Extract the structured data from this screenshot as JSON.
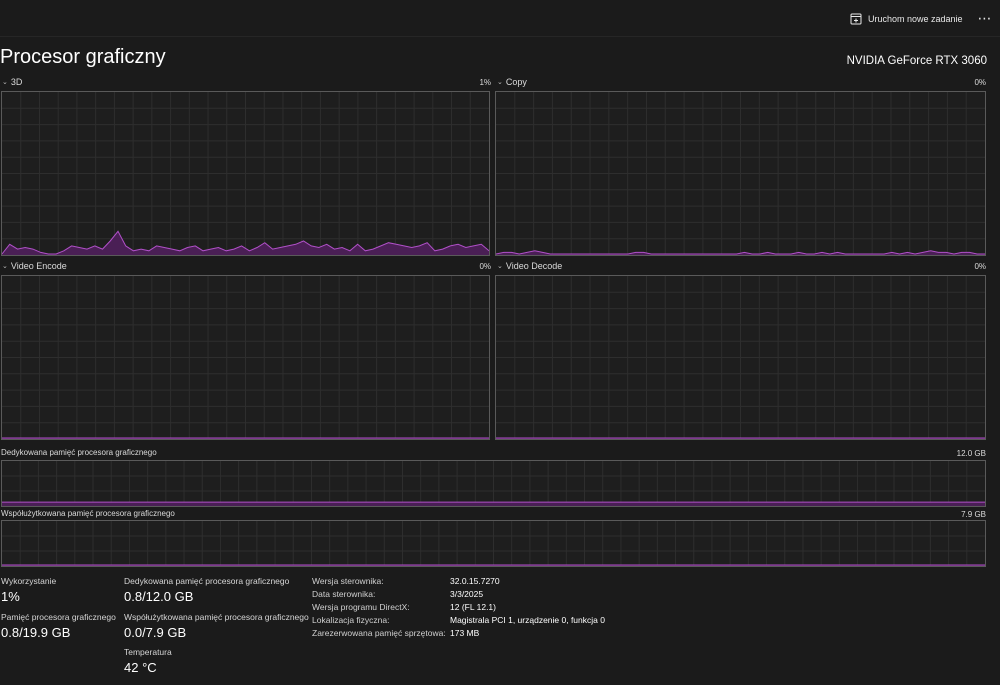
{
  "toolbar": {
    "run_task_label": "Uruchom nowe zadanie",
    "more_label": "⋯"
  },
  "header": {
    "title": "Procesor graficzny",
    "gpu_name": "NVIDIA GeForce RTX 3060"
  },
  "graphs": {
    "engine_3d": {
      "label": "3D",
      "pct": "1%"
    },
    "copy": {
      "label": "Copy",
      "pct": "0%"
    },
    "video_encode": {
      "label": "Video Encode",
      "pct": "0%"
    },
    "video_decode": {
      "label": "Video Decode",
      "pct": "0%"
    },
    "dedicated_memory": {
      "label": "Dedykowana pamięć procesora graficznego",
      "max": "12.0 GB"
    },
    "shared_memory": {
      "label": "Współużytkowana pamięć procesora graficznego",
      "max": "7.9 GB"
    }
  },
  "chart_data": [
    {
      "type": "area",
      "name": "3D",
      "ylim": [
        0,
        100
      ],
      "values": [
        0,
        6,
        3,
        4,
        3,
        1,
        0,
        0,
        2,
        5,
        4,
        3,
        5,
        3,
        8,
        14,
        5,
        2,
        3,
        2,
        5,
        4,
        3,
        2,
        4,
        5,
        2,
        3,
        4,
        2,
        3,
        5,
        2,
        4,
        7,
        3,
        4,
        5,
        6,
        8,
        5,
        4,
        6,
        3,
        4,
        2,
        6,
        2,
        3,
        5,
        7,
        6,
        5,
        4,
        5,
        7,
        2,
        3,
        5,
        6,
        4,
        5,
        6,
        2
      ]
    },
    {
      "type": "area",
      "name": "Copy",
      "ylim": [
        0,
        100
      ],
      "values": [
        0,
        1,
        1,
        0,
        1,
        2,
        1,
        0,
        0,
        0,
        0,
        0,
        0,
        0,
        0,
        0,
        0,
        0,
        1,
        1,
        0,
        0,
        0,
        0,
        0,
        0,
        0,
        0,
        0,
        0,
        0,
        0,
        1,
        0,
        0,
        1,
        0,
        0,
        0,
        1,
        0,
        0,
        1,
        0,
        1,
        0,
        0,
        0,
        0,
        0,
        0,
        1,
        0,
        1,
        0,
        1,
        2,
        1,
        1,
        0,
        1,
        1,
        0,
        0
      ]
    },
    {
      "type": "area",
      "name": "Video Encode",
      "ylim": [
        0,
        100
      ],
      "values": [
        0,
        0,
        0,
        0,
        0,
        0,
        0,
        0,
        0,
        0,
        0,
        0,
        0,
        0,
        0,
        0,
        0,
        0,
        0,
        0,
        0,
        0,
        0,
        0,
        0,
        0,
        0,
        0,
        0,
        0,
        0,
        0
      ]
    },
    {
      "type": "area",
      "name": "Video Decode",
      "ylim": [
        0,
        100
      ],
      "values": [
        0,
        0,
        0,
        0,
        0,
        0,
        0,
        0,
        0,
        0,
        0,
        0,
        0,
        0,
        0,
        0,
        0,
        0,
        0,
        0,
        0,
        0,
        0,
        0,
        0,
        0,
        0,
        0,
        0,
        0,
        0,
        0
      ]
    },
    {
      "type": "area",
      "name": "Dedykowana pamięć procesora graficznego",
      "ylim": [
        0,
        12.0
      ],
      "values": [
        0.8,
        0.8,
        0.8,
        0.8,
        0.8,
        0.8,
        0.8,
        0.8,
        0.8,
        0.8,
        0.8,
        0.8,
        0.8,
        0.8,
        0.8,
        0.8,
        0.8,
        0.8,
        0.8,
        0.8,
        0.8,
        0.8,
        0.8,
        0.8,
        0.8,
        0.8,
        0.8,
        0.8,
        0.8,
        0.8,
        0.8,
        0.8
      ]
    },
    {
      "type": "area",
      "name": "Współużytkowana pamięć procesora graficznego",
      "ylim": [
        0,
        7.9
      ],
      "values": [
        0,
        0,
        0,
        0,
        0,
        0,
        0,
        0,
        0,
        0,
        0,
        0,
        0,
        0,
        0,
        0,
        0,
        0,
        0,
        0,
        0,
        0,
        0,
        0,
        0,
        0,
        0,
        0,
        0,
        0,
        0,
        0
      ]
    }
  ],
  "stats": {
    "utilization": {
      "label": "Wykorzystanie",
      "value": "1%"
    },
    "gpu_memory": {
      "label": "Pamięć procesora graficznego",
      "value": "0.8/19.9 GB"
    },
    "dedicated": {
      "label": "Dedykowana pamięć procesora graficznego",
      "value": "0.8/12.0 GB"
    },
    "shared": {
      "label": "Współużytkowana pamięć procesora graficznego",
      "value": "0.0/7.9 GB"
    },
    "temperature": {
      "label": "Temperatura",
      "value": "42 °C"
    }
  },
  "info": [
    {
      "key": "Wersja sterownika:",
      "value": "32.0.15.7270"
    },
    {
      "key": "Data sterownika:",
      "value": "3/3/2025"
    },
    {
      "key": "Wersja programu DirectX:",
      "value": "12 (FL 12.1)"
    },
    {
      "key": "Lokalizacja fizyczna:",
      "value": "Magistrala PCI 1, urządzenie 0, funkcja 0"
    },
    {
      "key": "Zarezerwowana pamięć sprzętowa:",
      "value": "173 MB"
    }
  ],
  "colors": {
    "accent": "#b050c8",
    "accent_fill": "#4a1f55",
    "grid": "#2e2e2e",
    "border": "#5a5a5a"
  }
}
